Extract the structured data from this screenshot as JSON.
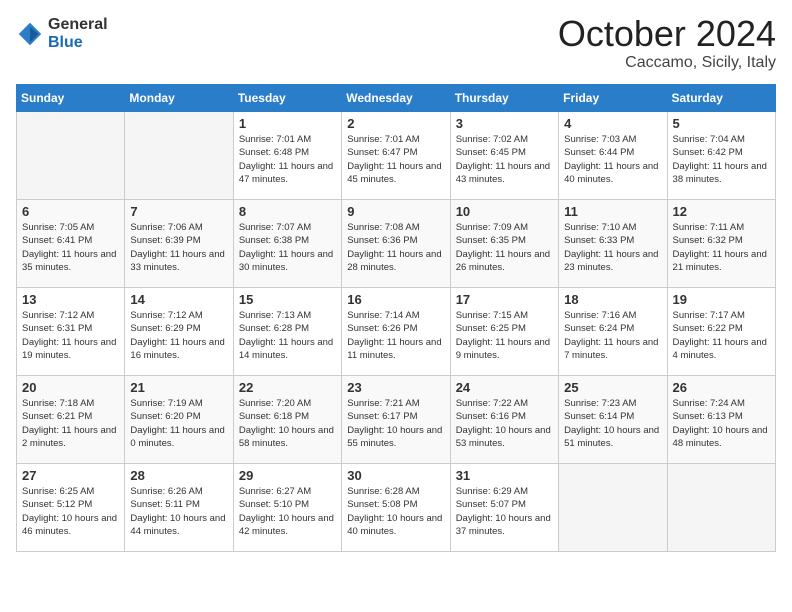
{
  "logo": {
    "general": "General",
    "blue": "Blue"
  },
  "header": {
    "month": "October 2024",
    "location": "Caccamo, Sicily, Italy"
  },
  "days_of_week": [
    "Sunday",
    "Monday",
    "Tuesday",
    "Wednesday",
    "Thursday",
    "Friday",
    "Saturday"
  ],
  "weeks": [
    [
      {
        "day": "",
        "empty": true
      },
      {
        "day": "",
        "empty": true
      },
      {
        "day": "1",
        "sunrise": "Sunrise: 7:01 AM",
        "sunset": "Sunset: 6:48 PM",
        "daylight": "Daylight: 11 hours and 47 minutes."
      },
      {
        "day": "2",
        "sunrise": "Sunrise: 7:01 AM",
        "sunset": "Sunset: 6:47 PM",
        "daylight": "Daylight: 11 hours and 45 minutes."
      },
      {
        "day": "3",
        "sunrise": "Sunrise: 7:02 AM",
        "sunset": "Sunset: 6:45 PM",
        "daylight": "Daylight: 11 hours and 43 minutes."
      },
      {
        "day": "4",
        "sunrise": "Sunrise: 7:03 AM",
        "sunset": "Sunset: 6:44 PM",
        "daylight": "Daylight: 11 hours and 40 minutes."
      },
      {
        "day": "5",
        "sunrise": "Sunrise: 7:04 AM",
        "sunset": "Sunset: 6:42 PM",
        "daylight": "Daylight: 11 hours and 38 minutes."
      }
    ],
    [
      {
        "day": "6",
        "sunrise": "Sunrise: 7:05 AM",
        "sunset": "Sunset: 6:41 PM",
        "daylight": "Daylight: 11 hours and 35 minutes."
      },
      {
        "day": "7",
        "sunrise": "Sunrise: 7:06 AM",
        "sunset": "Sunset: 6:39 PM",
        "daylight": "Daylight: 11 hours and 33 minutes."
      },
      {
        "day": "8",
        "sunrise": "Sunrise: 7:07 AM",
        "sunset": "Sunset: 6:38 PM",
        "daylight": "Daylight: 11 hours and 30 minutes."
      },
      {
        "day": "9",
        "sunrise": "Sunrise: 7:08 AM",
        "sunset": "Sunset: 6:36 PM",
        "daylight": "Daylight: 11 hours and 28 minutes."
      },
      {
        "day": "10",
        "sunrise": "Sunrise: 7:09 AM",
        "sunset": "Sunset: 6:35 PM",
        "daylight": "Daylight: 11 hours and 26 minutes."
      },
      {
        "day": "11",
        "sunrise": "Sunrise: 7:10 AM",
        "sunset": "Sunset: 6:33 PM",
        "daylight": "Daylight: 11 hours and 23 minutes."
      },
      {
        "day": "12",
        "sunrise": "Sunrise: 7:11 AM",
        "sunset": "Sunset: 6:32 PM",
        "daylight": "Daylight: 11 hours and 21 minutes."
      }
    ],
    [
      {
        "day": "13",
        "sunrise": "Sunrise: 7:12 AM",
        "sunset": "Sunset: 6:31 PM",
        "daylight": "Daylight: 11 hours and 19 minutes."
      },
      {
        "day": "14",
        "sunrise": "Sunrise: 7:12 AM",
        "sunset": "Sunset: 6:29 PM",
        "daylight": "Daylight: 11 hours and 16 minutes."
      },
      {
        "day": "15",
        "sunrise": "Sunrise: 7:13 AM",
        "sunset": "Sunset: 6:28 PM",
        "daylight": "Daylight: 11 hours and 14 minutes."
      },
      {
        "day": "16",
        "sunrise": "Sunrise: 7:14 AM",
        "sunset": "Sunset: 6:26 PM",
        "daylight": "Daylight: 11 hours and 11 minutes."
      },
      {
        "day": "17",
        "sunrise": "Sunrise: 7:15 AM",
        "sunset": "Sunset: 6:25 PM",
        "daylight": "Daylight: 11 hours and 9 minutes."
      },
      {
        "day": "18",
        "sunrise": "Sunrise: 7:16 AM",
        "sunset": "Sunset: 6:24 PM",
        "daylight": "Daylight: 11 hours and 7 minutes."
      },
      {
        "day": "19",
        "sunrise": "Sunrise: 7:17 AM",
        "sunset": "Sunset: 6:22 PM",
        "daylight": "Daylight: 11 hours and 4 minutes."
      }
    ],
    [
      {
        "day": "20",
        "sunrise": "Sunrise: 7:18 AM",
        "sunset": "Sunset: 6:21 PM",
        "daylight": "Daylight: 11 hours and 2 minutes."
      },
      {
        "day": "21",
        "sunrise": "Sunrise: 7:19 AM",
        "sunset": "Sunset: 6:20 PM",
        "daylight": "Daylight: 11 hours and 0 minutes."
      },
      {
        "day": "22",
        "sunrise": "Sunrise: 7:20 AM",
        "sunset": "Sunset: 6:18 PM",
        "daylight": "Daylight: 10 hours and 58 minutes."
      },
      {
        "day": "23",
        "sunrise": "Sunrise: 7:21 AM",
        "sunset": "Sunset: 6:17 PM",
        "daylight": "Daylight: 10 hours and 55 minutes."
      },
      {
        "day": "24",
        "sunrise": "Sunrise: 7:22 AM",
        "sunset": "Sunset: 6:16 PM",
        "daylight": "Daylight: 10 hours and 53 minutes."
      },
      {
        "day": "25",
        "sunrise": "Sunrise: 7:23 AM",
        "sunset": "Sunset: 6:14 PM",
        "daylight": "Daylight: 10 hours and 51 minutes."
      },
      {
        "day": "26",
        "sunrise": "Sunrise: 7:24 AM",
        "sunset": "Sunset: 6:13 PM",
        "daylight": "Daylight: 10 hours and 48 minutes."
      }
    ],
    [
      {
        "day": "27",
        "sunrise": "Sunrise: 6:25 AM",
        "sunset": "Sunset: 5:12 PM",
        "daylight": "Daylight: 10 hours and 46 minutes."
      },
      {
        "day": "28",
        "sunrise": "Sunrise: 6:26 AM",
        "sunset": "Sunset: 5:11 PM",
        "daylight": "Daylight: 10 hours and 44 minutes."
      },
      {
        "day": "29",
        "sunrise": "Sunrise: 6:27 AM",
        "sunset": "Sunset: 5:10 PM",
        "daylight": "Daylight: 10 hours and 42 minutes."
      },
      {
        "day": "30",
        "sunrise": "Sunrise: 6:28 AM",
        "sunset": "Sunset: 5:08 PM",
        "daylight": "Daylight: 10 hours and 40 minutes."
      },
      {
        "day": "31",
        "sunrise": "Sunrise: 6:29 AM",
        "sunset": "Sunset: 5:07 PM",
        "daylight": "Daylight: 10 hours and 37 minutes."
      },
      {
        "day": "",
        "empty": true
      },
      {
        "day": "",
        "empty": true
      }
    ]
  ]
}
